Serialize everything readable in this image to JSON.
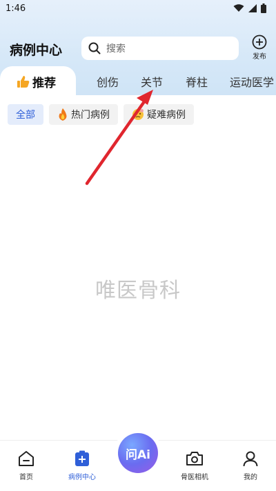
{
  "status_bar": {
    "time": "1:46"
  },
  "header": {
    "title": "病例中心",
    "search_placeholder": "搜索",
    "publish_label": "发布"
  },
  "tabs": [
    {
      "label": "推荐",
      "active": true
    },
    {
      "label": "创伤"
    },
    {
      "label": "关节"
    },
    {
      "label": "脊柱"
    },
    {
      "label": "运动医学"
    }
  ],
  "chips": [
    {
      "label": "全部",
      "active": true
    },
    {
      "label": "热门病例",
      "icon": "fire-icon"
    },
    {
      "label": "疑难病例",
      "icon": "confused-face-icon"
    }
  ],
  "watermark": "唯医骨科",
  "bottom_nav": {
    "home": "首页",
    "cases": "病例中心",
    "ai": "问Ai",
    "camera": "骨医相机",
    "mine": "我的"
  },
  "colors": {
    "accent": "#2f5fd8",
    "arrow": "#e0262e"
  }
}
